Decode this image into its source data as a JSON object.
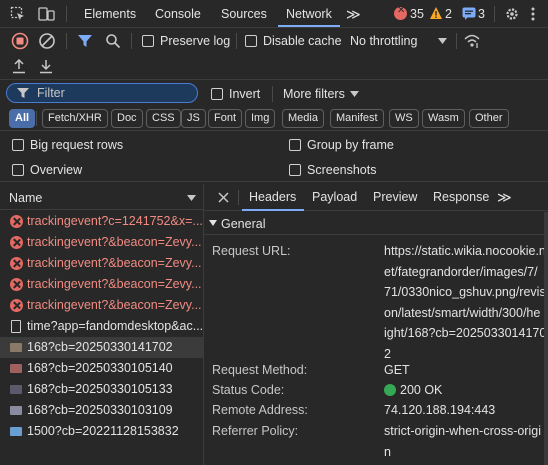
{
  "tabs": {
    "elements": "Elements",
    "console": "Console",
    "sources": "Sources",
    "network": "Network",
    "more": "≫"
  },
  "counters": {
    "errors": "35",
    "warnings": "2",
    "issues": "3"
  },
  "toolbar": {
    "preserve_log": "Preserve log",
    "disable_cache": "Disable cache",
    "throttling": "No throttling"
  },
  "filter": {
    "placeholder": "Filter",
    "invert": "Invert",
    "more_filters": "More filters"
  },
  "chips": [
    "All",
    "Fetch/XHR",
    "Doc",
    "CSS",
    "JS",
    "Font",
    "Img",
    "Media",
    "Manifest",
    "WS",
    "Wasm",
    "Other"
  ],
  "options": {
    "big_rows": "Big request rows",
    "group_by_frame": "Group by frame",
    "overview": "Overview",
    "screenshots": "Screenshots"
  },
  "list": {
    "header": "Name",
    "requests": [
      {
        "name": "trackingevent?c=1241752&x=...",
        "kind": "error"
      },
      {
        "name": "trackingevent?&beacon=Zevy...",
        "kind": "error"
      },
      {
        "name": "trackingevent?&beacon=Zevy...",
        "kind": "error"
      },
      {
        "name": "trackingevent?&beacon=Zevy...",
        "kind": "error"
      },
      {
        "name": "trackingevent?&beacon=Zevy...",
        "kind": "error"
      },
      {
        "name": "time?app=fandomdesktop&ac...",
        "kind": "doc"
      },
      {
        "name": "168?cb=20250330141702",
        "kind": "image",
        "selected": true
      },
      {
        "name": "168?cb=20250330105140",
        "kind": "image"
      },
      {
        "name": "168?cb=20250330105133",
        "kind": "image"
      },
      {
        "name": "168?cb=20250330103109",
        "kind": "image"
      },
      {
        "name": "1500?cb=20221128153832",
        "kind": "image"
      }
    ]
  },
  "detail": {
    "tabs": [
      "Headers",
      "Payload",
      "Preview",
      "Response"
    ],
    "section": "General",
    "request_url_key": "Request URL:",
    "request_url_lines": [
      "https://static.wikia.nocookie.n",
      "et/fategrandorder/images/7/",
      "71/0330nico_gshuv.png/revisi",
      "on/latest/smart/width/300/he",
      "ight/168?cb=2025033014170",
      "2"
    ],
    "method_key": "Request Method:",
    "method_val": "GET",
    "status_key": "Status Code:",
    "status_val": "200 OK",
    "remote_key": "Remote Address:",
    "remote_val": "74.120.188.194:443",
    "referrer_key": "Referrer Policy:",
    "referrer_val_lines": [
      "strict-origin-when-cross-origi",
      "n"
    ]
  },
  "colors": {
    "accent": "#7cacf8",
    "error": "#f28b82",
    "status_ok": "#34a853",
    "warning": "#f9a825"
  }
}
